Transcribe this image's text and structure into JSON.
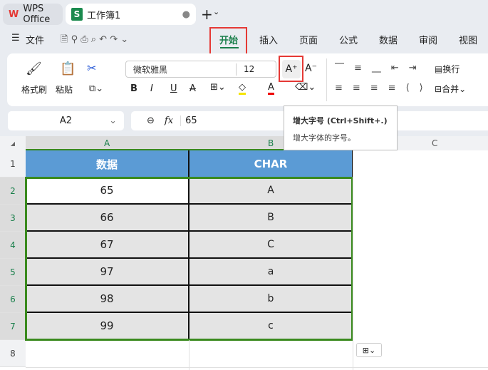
{
  "tabs": {
    "app": "WPS Office",
    "doc": "工作簿1",
    "add": "+",
    "add_caret": "⌄"
  },
  "menu": {
    "file": "文件",
    "items": [
      "开始",
      "插入",
      "页面",
      "公式",
      "数据",
      "审阅",
      "视图"
    ]
  },
  "ribbon": {
    "format_painter": "格式刷",
    "paste": "粘贴",
    "font_name": "微软雅黑",
    "font_size": "12",
    "wrap": "换行",
    "merge": "合并",
    "bold": "B",
    "italic": "I",
    "underline": "U",
    "inc_font": "A⁺",
    "dec_font": "A⁻"
  },
  "formula": {
    "cell_ref": "A2",
    "fx": "fx",
    "value": "65"
  },
  "tooltip": {
    "title": "增大字号 (Ctrl+Shift+.)",
    "desc": "增大字体的字号。"
  },
  "columns": [
    "A",
    "B",
    "C"
  ],
  "rows": [
    "1",
    "2",
    "3",
    "4",
    "5",
    "6",
    "7",
    "8"
  ],
  "table": {
    "headers": [
      "数据",
      "CHAR"
    ],
    "data": [
      [
        "65",
        "A"
      ],
      [
        "66",
        "B"
      ],
      [
        "67",
        "C"
      ],
      [
        "97",
        "a"
      ],
      [
        "98",
        "b"
      ],
      [
        "99",
        "c"
      ]
    ]
  },
  "colors": {
    "header_bg": "#5b9bd5",
    "selection": "#3a8a1e",
    "highlight": "#e53935",
    "accent": "#1a7f4b"
  }
}
